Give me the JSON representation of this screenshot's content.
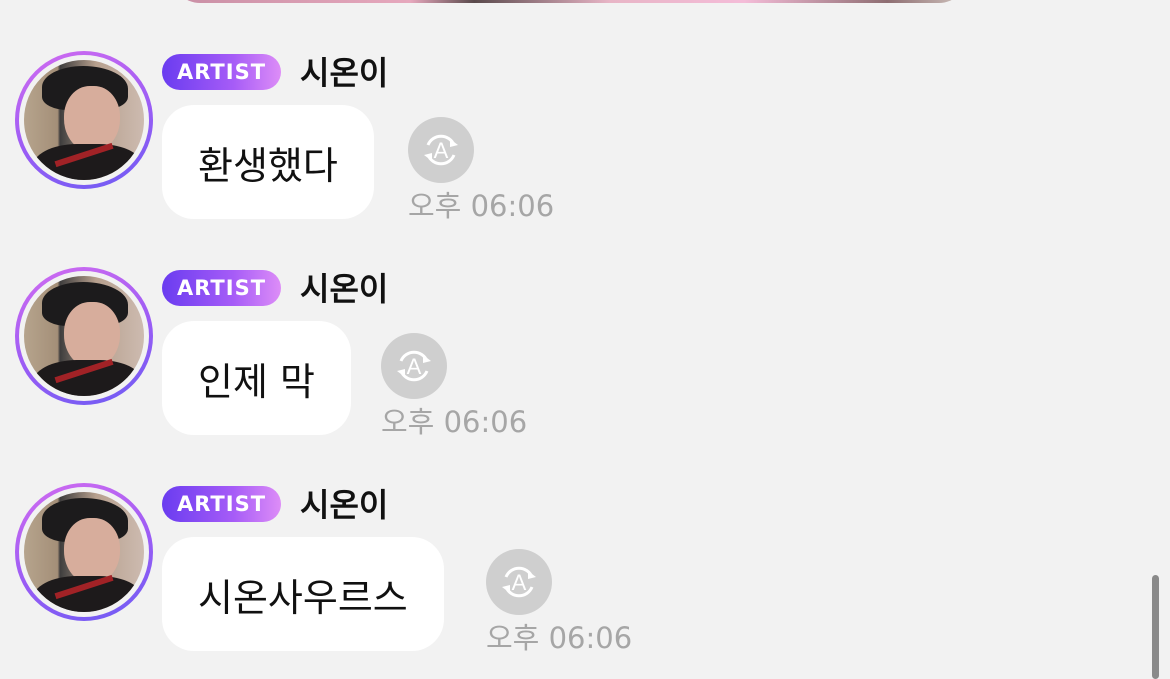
{
  "chat": {
    "messages": [
      {
        "badge": "ARTIST",
        "sender": "시온이",
        "text": "환생했다",
        "time": "오후 06:06"
      },
      {
        "badge": "ARTIST",
        "sender": "시온이",
        "text": "인제 막",
        "time": "오후 06:06"
      },
      {
        "badge": "ARTIST",
        "sender": "시온이",
        "text": "시온사우르스",
        "time": "오후 06:06"
      }
    ]
  },
  "icons": {
    "translate": "translate-icon",
    "avatar": "avatar-photo"
  },
  "colors": {
    "badge_start": "#6a3cf0",
    "badge_end": "#dd8df7",
    "ring": "#9a5cf5",
    "bubble": "#ffffff",
    "background": "#f2f2f2",
    "time_text": "#a6a6a6"
  }
}
